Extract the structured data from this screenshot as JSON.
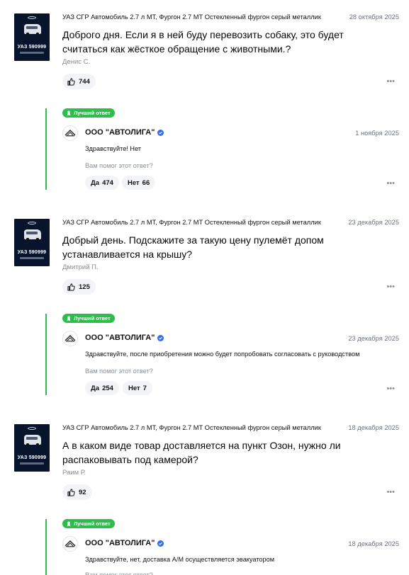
{
  "items": [
    {
      "product": "УАЗ СГР Автомобиль 2.7 л МТ, Фургон 2.7 МТ Остекленный фургон серый металлик",
      "date": "28 октября 2025",
      "question": "Доброго дня. Если я в ней буду перевозить собаку, это будет считаться как жёсткое обращение с животными.?",
      "author": "Денис С.",
      "likes": "744",
      "thumb_price": "УАЗ 590999",
      "best_label": "Лучший ответ",
      "seller": "ООО \"АВТОЛИГА\"",
      "answer_date": "1 ноября 2025",
      "answer": "Здравствуйте! Нет",
      "helpful": "Вам помог этот ответ?",
      "yes_label": "Да",
      "yes_count": "474",
      "no_label": "Нет",
      "no_count": "66"
    },
    {
      "product": "УАЗ СГР Автомобиль 2.7 л МТ, Фургон 2.7 МТ Остекленный фургон серый металлик",
      "date": "23 декабря 2025",
      "question": "Добрый день. Подскажите за такую цену пулемёт допом устанавливается на крышу?",
      "author": "Дмитрий П.",
      "likes": "125",
      "thumb_price": "УАЗ 590999",
      "best_label": "Лучший ответ",
      "seller": "ООО \"АВТОЛИГА\"",
      "answer_date": "23 декабря 2025",
      "answer": "Здравствуйте, после приобретения можно будет попробовать согласовать с руководством",
      "helpful": "Вам помог этот ответ?",
      "yes_label": "Да",
      "yes_count": "254",
      "no_label": "Нет",
      "no_count": "7"
    },
    {
      "product": "УАЗ СГР Автомобиль 2.7 л МТ, Фургон 2.7 МТ Остекленный фургон серый металлик",
      "date": "18 декабря 2025",
      "question": "А в каком виде товар доставляется на пункт Озон, нужно ли распаковывать под камерой?",
      "author": "Раим Р.",
      "likes": "92",
      "thumb_price": "УАЗ 590999",
      "best_label": "Лучший ответ",
      "seller": "ООО \"АВТОЛИГА\"",
      "answer_date": "18 декабря 2025",
      "answer": "Здравствуйте, нет, доставка А/М осуществляется эвакуатором",
      "helpful": "Вам помог этот ответ?"
    }
  ],
  "colors": {
    "green": "#2dbd4a",
    "verified": "#2f6df6",
    "pill_bg": "#f2f4f7"
  },
  "icons": [
    "like-icon",
    "more-icon",
    "best-answer-icon",
    "verified-icon",
    "seller-logo-icon"
  ]
}
